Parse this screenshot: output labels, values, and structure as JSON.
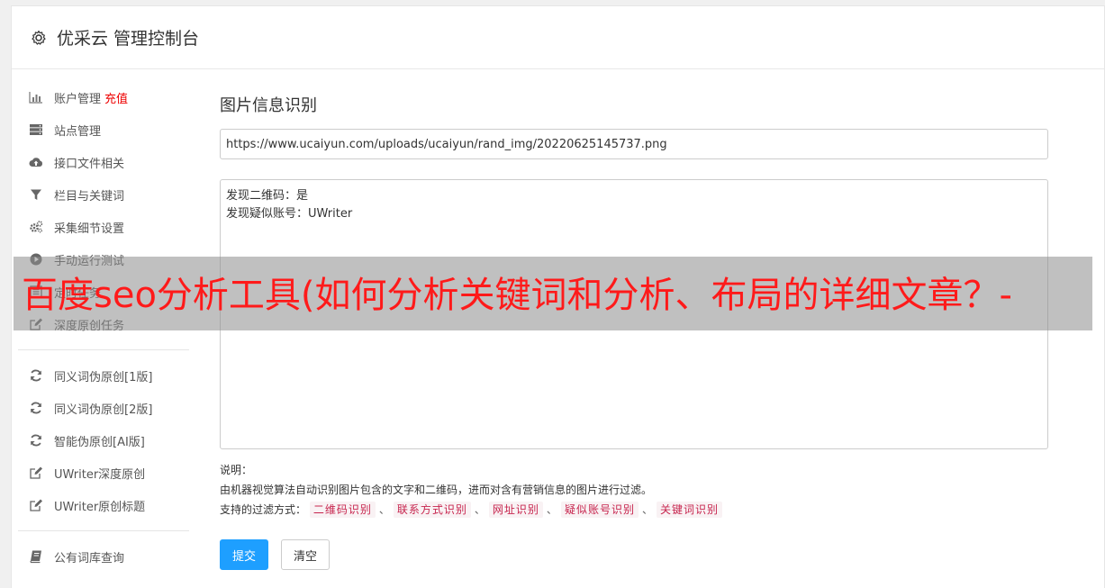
{
  "header": {
    "title": "优采云 管理控制台"
  },
  "sidebar": {
    "group1": [
      {
        "label": "账户管理",
        "extra": "充值",
        "icon": "bar-chart-icon"
      },
      {
        "label": "站点管理",
        "icon": "server-icon"
      },
      {
        "label": "接口文件相关",
        "icon": "cloud-upload-icon"
      },
      {
        "label": "栏目与关键词",
        "icon": "filter-icon"
      },
      {
        "label": "采集细节设置",
        "icon": "gears-icon"
      },
      {
        "label": "手动运行测试",
        "icon": "play-circle-icon"
      },
      {
        "label": "定时任务",
        "icon": "tasks-icon"
      },
      {
        "label": "深度原创任务",
        "icon": "edit-icon"
      }
    ],
    "group2": [
      {
        "label": "同义词伪原创[1版]",
        "icon": "refresh-icon"
      },
      {
        "label": "同义词伪原创[2版]",
        "icon": "refresh-icon"
      },
      {
        "label": "智能伪原创[AI版]",
        "icon": "refresh-icon"
      },
      {
        "label": "UWriter深度原创",
        "icon": "edit-icon"
      },
      {
        "label": "UWriter原创标题",
        "icon": "edit-icon"
      }
    ],
    "group3": [
      {
        "label": "公有词库查询",
        "icon": "book-icon"
      }
    ]
  },
  "main": {
    "title": "图片信息识别",
    "url_value": "https://www.ucaiyun.com/uploads/ucaiyun/rand_img/20220625145737.png",
    "result_lines": [
      "发现二维码：是",
      "发现疑似账号：UWriter"
    ],
    "notes_label": "说明：",
    "notes_text": "由机器视觉算法自动识别图片包含的文字和二维码，进而对含有营销信息的图片进行过滤。",
    "filters_label": "支持的过滤方式：",
    "filters": [
      "二维码识别",
      "联系方式识别",
      "网址识别",
      "疑似账号识别",
      "关键词识别"
    ],
    "filter_separator": "、",
    "submit_label": "提交",
    "clear_label": "清空"
  },
  "overlay": {
    "text": "百度seo分析工具(如何分析关键词和分析、布局的详细文章？-"
  },
  "colors": {
    "primary": "#1e9fff",
    "tag_text": "#c7254e",
    "tag_bg": "#f9f2f4",
    "overlay_text": "#ff1a1a",
    "extra_red": "#e00000"
  }
}
